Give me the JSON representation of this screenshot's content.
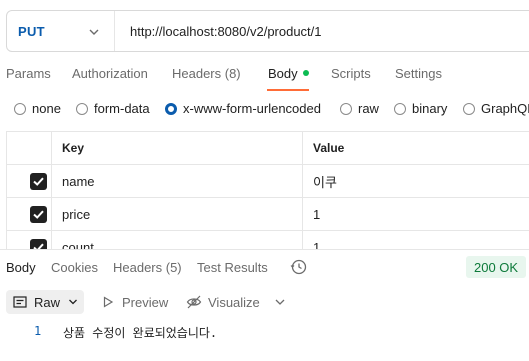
{
  "request": {
    "method": "PUT",
    "url": "http://localhost:8080/v2/product/1"
  },
  "request_tabs": [
    {
      "label": "Params"
    },
    {
      "label": "Authorization"
    },
    {
      "label": "Headers (8)"
    },
    {
      "label": "Body"
    },
    {
      "label": "Scripts"
    },
    {
      "label": "Settings"
    }
  ],
  "body_types": [
    {
      "label": "none",
      "selected": false
    },
    {
      "label": "form-data",
      "selected": false
    },
    {
      "label": "x-www-form-urlencoded",
      "selected": true
    },
    {
      "label": "raw",
      "selected": false
    },
    {
      "label": "binary",
      "selected": false
    },
    {
      "label": "GraphQL",
      "selected": false
    }
  ],
  "table": {
    "headers": {
      "key": "Key",
      "value": "Value"
    },
    "rows": [
      {
        "key": "name",
        "value": "이쿠",
        "checked": true
      },
      {
        "key": "price",
        "value": "1",
        "checked": true
      },
      {
        "key": "count",
        "value": "1",
        "checked": true
      }
    ]
  },
  "response": {
    "tabs": [
      {
        "label": "Body"
      },
      {
        "label": "Cookies"
      },
      {
        "label": "Headers (5)"
      },
      {
        "label": "Test Results"
      }
    ],
    "status": "200 OK",
    "status_color": "#0d7a3a",
    "format": "Raw",
    "preview_label": "Preview",
    "visualize_label": "Visualize",
    "lines": [
      {
        "no": "1",
        "text": "상품 수정이 완료되었습니다."
      }
    ]
  },
  "colors": {
    "accent": "#ff6c37",
    "method": "#0b5cad",
    "body_dot": "#0cbb52"
  }
}
